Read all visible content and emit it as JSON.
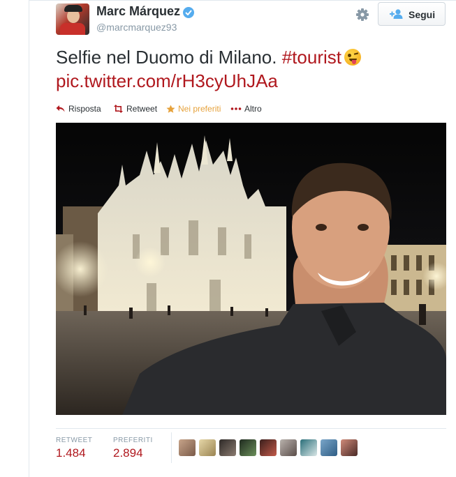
{
  "tweet": {
    "author": {
      "name": "Marc Márquez",
      "handle": "@marcmarquez93",
      "verified": true
    },
    "follow_label": "Segui",
    "text": "Selfie nel Duomo di Milano. ",
    "hashtag": "#tourist",
    "link": "pic.twitter.com/rH3cyUhJAa",
    "actions": {
      "reply": "Risposta",
      "retweet": "Retweet",
      "favorite": "Nei preferiti",
      "more": "Altro"
    },
    "stats": {
      "retweet_label": "RETWEET",
      "retweet_count": "1.484",
      "favorites_label": "PREFERITI",
      "favorites_count": "2.894"
    },
    "favoriter_avatars": 9
  },
  "colors": {
    "link": "#b0181e",
    "favorite_active": "#e6a23c",
    "verified_badge": "#55acee",
    "muted": "#8899a6"
  },
  "icons": [
    "gear-icon",
    "follow-user-icon",
    "verified-icon",
    "reply-icon",
    "retweet-icon",
    "star-icon",
    "more-icon"
  ]
}
